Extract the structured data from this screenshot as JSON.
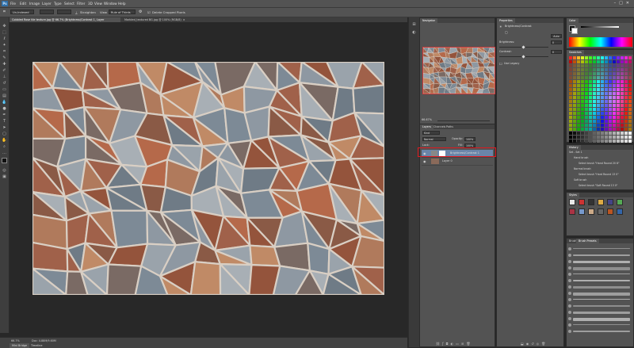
{
  "app": {
    "logo": "Ps"
  },
  "menubar": {
    "items": [
      "File",
      "Edit",
      "Image",
      "Layer",
      "Type",
      "Select",
      "Filter",
      "3D",
      "View",
      "Window",
      "Help"
    ]
  },
  "window_controls": {
    "minimize": "–",
    "maximize": "□",
    "close": "✕"
  },
  "options_bar": {
    "mode_value": "Un-Indexed",
    "size_value": "",
    "auto_select_label": "Straighten",
    "view_label": "View",
    "view_value": "Rule of Thirds",
    "delete_cropped_label": "Delete Cropped Pixels"
  },
  "tabs": [
    {
      "label": "Cobbled Rose tile texture.jpg @ 66.7% (Brightness/Contrast 1, Layer Mask/8)*",
      "active": true
    },
    {
      "label": "Marbled_textured BG.jpg @ 100% (RGB/8)",
      "active": false
    }
  ],
  "status": {
    "zoom": "66.7%",
    "doc": "Doc: 4.88M/9.60M",
    "tab_label": "Mini Bridge",
    "tab2_label": "Timeline"
  },
  "navigator": {
    "tab": "Navigator",
    "zoom": "66.67%"
  },
  "properties": {
    "tab": "Properties",
    "title": "Brightness/Contrast",
    "auto_button": "Auto",
    "brightness_label": "Brightness:",
    "brightness_value": "0",
    "contrast_label": "Contrast:",
    "contrast_value": "0",
    "use_legacy_label": "Use Legacy"
  },
  "layers": {
    "tabs": [
      "Layers",
      "Channels",
      "Paths"
    ],
    "blend_mode": "Normal",
    "opacity_label": "Opacity:",
    "opacity_value": "100%",
    "lock_label": "Lock:",
    "fill_label": "Fill:",
    "fill_value": "100%",
    "kind_label": "Kind",
    "rows": [
      {
        "name": "Brightness/Contrast 1",
        "selected": true
      },
      {
        "name": "Layer 0",
        "selected": false
      }
    ]
  },
  "color": {
    "tab": "Color"
  },
  "swatches": {
    "tab": "Swatches"
  },
  "history": {
    "tab": "History",
    "rows": [
      "Set - Set 1",
      "Hand brush",
      "Select brush \"Hand Round 20 8\"",
      "Normal brush",
      "Select brush \"Hard Round 13 0\"",
      "Soft brush",
      "Select brush \"Soft Round 13 0\""
    ]
  },
  "styles": {
    "tab": "Styles"
  },
  "brush": {
    "tabs": [
      "Brush",
      "Brush Presets"
    ]
  },
  "colors": {
    "ui_bg": "#535353",
    "canvas_bg": "#282828",
    "selection": "#6a85a9",
    "highlight": "#e0191f"
  }
}
